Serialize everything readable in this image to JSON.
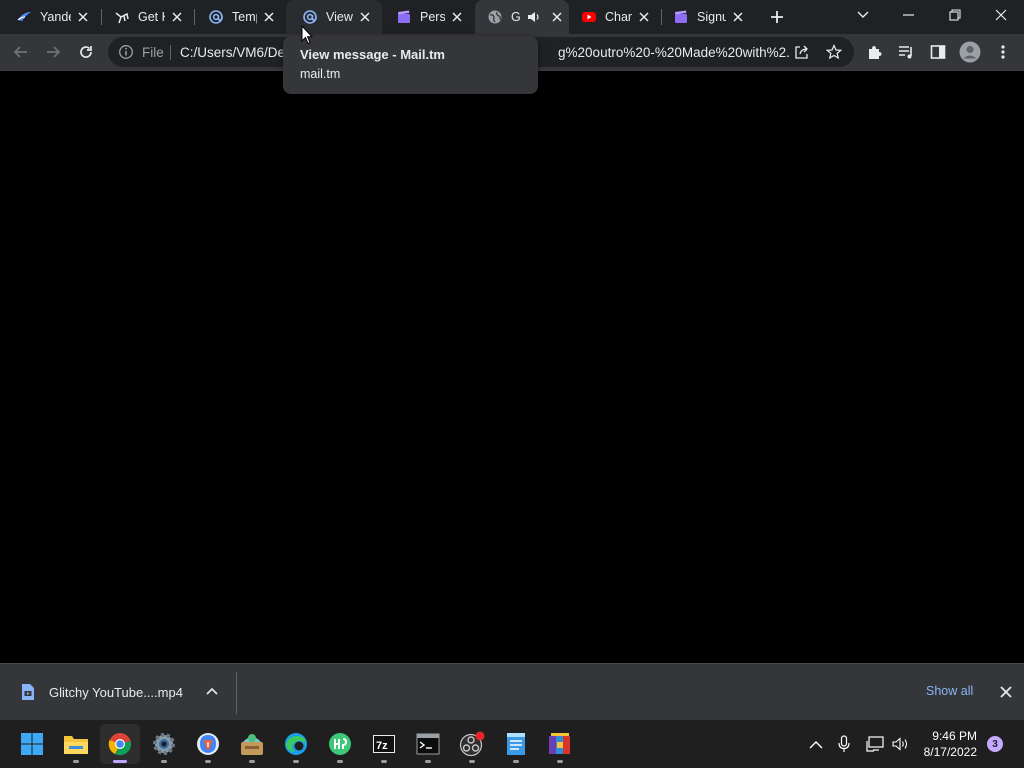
{
  "browser": {
    "tabs": [
      {
        "title": "Yande",
        "favicon": "yandex-icon",
        "active": false
      },
      {
        "title": "Get K",
        "favicon": "bird-icon",
        "active": false
      },
      {
        "title": "Temp",
        "favicon": "at-sign-icon",
        "active": false
      },
      {
        "title": "View",
        "favicon": "at-sign-icon",
        "active": false,
        "hovered": true
      },
      {
        "title": "Perso",
        "favicon": "clapper-icon",
        "active": false
      },
      {
        "title": "G",
        "favicon": "globe-icon",
        "active": true,
        "audio": true
      },
      {
        "title": "Chan",
        "favicon": "youtube-icon",
        "active": false
      },
      {
        "title": "Signu",
        "favicon": "clapper-icon",
        "active": false
      }
    ],
    "omnibox": {
      "scheme_label": "File",
      "url_visible_start": "C:/Users/VM6/De",
      "url_visible_end": "g%20outro%20-%20Made%20with%2..."
    },
    "tooltip": {
      "title": "View message - Mail.tm",
      "subtitle": "mail.tm"
    }
  },
  "download_bar": {
    "file_name": "Glitchy YouTube....mp4",
    "show_all_label": "Show all"
  },
  "taskbar": {
    "apps": [
      "windows-start-icon",
      "file-explorer-icon",
      "chrome-icon",
      "settings-icon",
      "brave-icon",
      "game-icon",
      "edge-icon",
      "green-app-icon",
      "7zip-icon",
      "terminal-icon",
      "obs-icon",
      "notepad-icon",
      "winrar-icon"
    ],
    "active_app": "chrome-icon",
    "clock": {
      "time": "9:46 PM",
      "date": "8/17/2022"
    },
    "notification_count": "3"
  },
  "colors": {
    "tabstrip": "#202124",
    "toolbar": "#35363a",
    "accent_link": "#8ab4f8",
    "taskbar": "#1f1f1f"
  }
}
